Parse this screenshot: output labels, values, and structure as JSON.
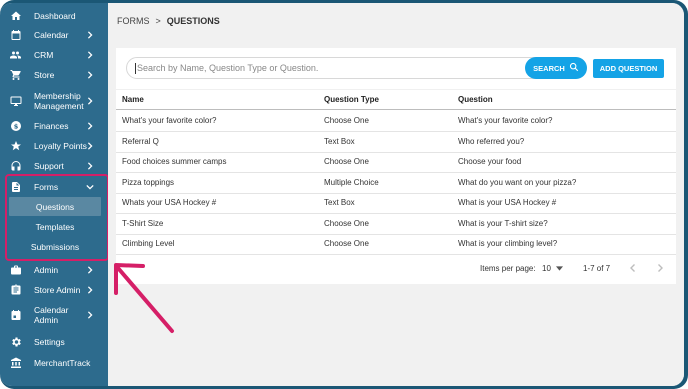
{
  "sidebar": {
    "items": [
      {
        "label": "Dashboard",
        "icon": "home-icon"
      },
      {
        "label": "Calendar",
        "icon": "calendar-icon"
      },
      {
        "label": "CRM",
        "icon": "people-icon"
      },
      {
        "label": "Store",
        "icon": "cart-icon"
      },
      {
        "label": "Membership Management",
        "icon": "monitor-icon"
      },
      {
        "label": "Finances",
        "icon": "dollar-icon"
      },
      {
        "label": "Loyalty Points",
        "icon": "star-icon"
      },
      {
        "label": "Support",
        "icon": "headset-icon"
      },
      {
        "label": "Forms",
        "icon": "document-icon"
      },
      {
        "label": "Admin",
        "icon": "briefcase-icon"
      },
      {
        "label": "Store Admin",
        "icon": "clipboard-icon"
      },
      {
        "label": "Calendar Admin",
        "icon": "calendar-admin-icon"
      },
      {
        "label": "Settings",
        "icon": "gear-icon"
      },
      {
        "label": "MerchantTrack",
        "icon": "bank-icon"
      }
    ],
    "forms_submenu": [
      {
        "label": "Questions",
        "active": true
      },
      {
        "label": "Templates",
        "active": false
      },
      {
        "label": "Submissions",
        "active": false
      }
    ]
  },
  "breadcrumb": {
    "parent": "FORMS",
    "separator": ">",
    "current": "QUESTIONS"
  },
  "search": {
    "placeholder": "Search by Name, Question Type or Question.",
    "button_label": "SEARCH",
    "add_label": "ADD QUESTION"
  },
  "table": {
    "columns": [
      "Name",
      "Question Type",
      "Question"
    ],
    "rows": [
      [
        "What's your favorite color?",
        "Choose One",
        "What's your favorite color?"
      ],
      [
        "Referral Q",
        "Text Box",
        "Who referred you?"
      ],
      [
        "Food choices summer camps",
        "Choose One",
        "Choose your food"
      ],
      [
        "Pizza toppings",
        "Multiple Choice",
        "What do you want on your pizza?"
      ],
      [
        "Whats your USA Hockey #",
        "Text Box",
        "What is your USA Hockey #"
      ],
      [
        "T-Shirt Size",
        "Choose One",
        "What is your T-shirt size?"
      ],
      [
        "Climbing Level",
        "Choose One",
        "What is your climbing level?"
      ]
    ]
  },
  "pagination": {
    "items_per_page_label": "Items per page:",
    "items_per_page_value": "10",
    "range": "1-7 of 7"
  },
  "colors": {
    "sidebar": "#2d6b8d",
    "accent": "#14a3e6",
    "highlight": "#d51f67"
  }
}
